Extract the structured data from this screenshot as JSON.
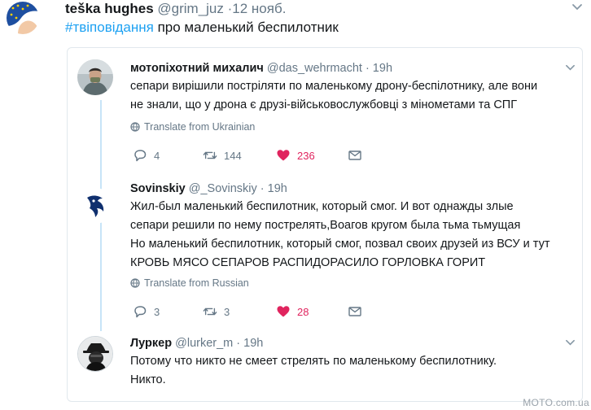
{
  "outer_tweet": {
    "name": "teška hughes",
    "handle": "@grim_juz",
    "time": "·12 нояб.",
    "hashtag": "#твіповідання",
    "text": " про маленький беспилотник"
  },
  "replies": [
    {
      "name": "мотопіхотний михалич",
      "handle": "@das_wehrmacht",
      "time": "· 19h",
      "lines": [
        "сепари вирішили постріляти по маленькому дрону-беспілотнику, але вони",
        "не знали, що у дрона є друзі-військовослужбовці з мінометами та СПГ"
      ],
      "translate": "Translate from Ukrainian",
      "replies_count": "4",
      "retweets_count": "144",
      "likes_count": "236"
    },
    {
      "name": "Sovinskiy",
      "handle": "@_Sovinskiy",
      "time": "· 19h",
      "lines": [
        "Жил-был маленький беспилотник, который смог. И вот однажды злые",
        "сепари решили по нему пострелять,Воагов кругом была тьма тьмущая",
        "Но маленький беспилотник, который смог, позвал своих друзей из ВСУ и тут",
        "КРОВЬ МЯСО СЕПАРОВ РАСПИДОРАСИЛО ГОРЛОВКА ГОРИТ"
      ],
      "translate": "Translate from Russian",
      "replies_count": "3",
      "retweets_count": "3",
      "likes_count": "28"
    },
    {
      "name": "Луркер",
      "handle": "@lurker_m",
      "time": "· 19h",
      "lines": [
        "Потому что никто не смеет стрелять по маленькому беспилотнику.",
        "Никто."
      ]
    }
  ],
  "watermark": "MOTO.com.ua",
  "colors": {
    "text": "#14171a",
    "secondary": "#657786",
    "link": "#1da1f2",
    "like": "#e0245e",
    "thread_line": "#c7e4f7"
  }
}
